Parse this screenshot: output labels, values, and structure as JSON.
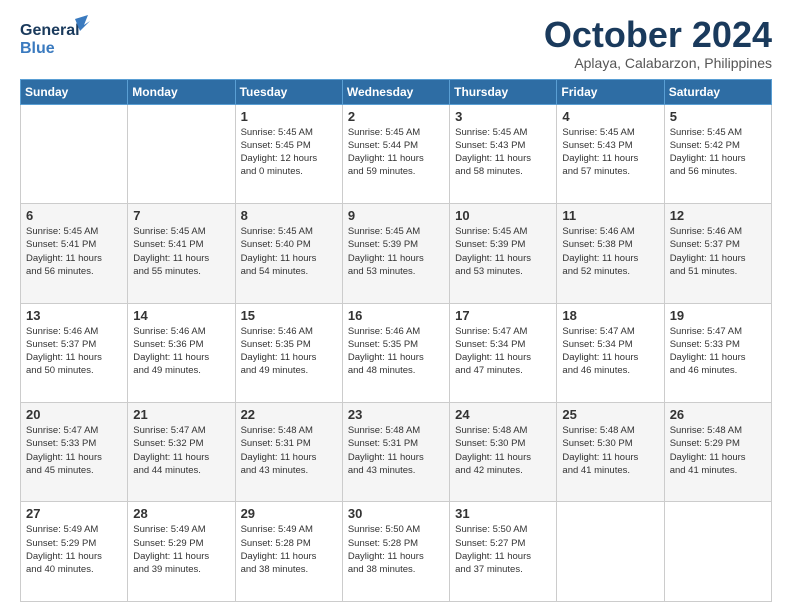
{
  "header": {
    "logo_general": "General",
    "logo_blue": "Blue",
    "month_title": "October 2024",
    "location": "Aplaya, Calabarzon, Philippines"
  },
  "weekdays": [
    "Sunday",
    "Monday",
    "Tuesday",
    "Wednesday",
    "Thursday",
    "Friday",
    "Saturday"
  ],
  "weeks": [
    [
      {
        "day": "",
        "info": ""
      },
      {
        "day": "",
        "info": ""
      },
      {
        "day": "1",
        "info": "Sunrise: 5:45 AM\nSunset: 5:45 PM\nDaylight: 12 hours\nand 0 minutes."
      },
      {
        "day": "2",
        "info": "Sunrise: 5:45 AM\nSunset: 5:44 PM\nDaylight: 11 hours\nand 59 minutes."
      },
      {
        "day": "3",
        "info": "Sunrise: 5:45 AM\nSunset: 5:43 PM\nDaylight: 11 hours\nand 58 minutes."
      },
      {
        "day": "4",
        "info": "Sunrise: 5:45 AM\nSunset: 5:43 PM\nDaylight: 11 hours\nand 57 minutes."
      },
      {
        "day": "5",
        "info": "Sunrise: 5:45 AM\nSunset: 5:42 PM\nDaylight: 11 hours\nand 56 minutes."
      }
    ],
    [
      {
        "day": "6",
        "info": "Sunrise: 5:45 AM\nSunset: 5:41 PM\nDaylight: 11 hours\nand 56 minutes."
      },
      {
        "day": "7",
        "info": "Sunrise: 5:45 AM\nSunset: 5:41 PM\nDaylight: 11 hours\nand 55 minutes."
      },
      {
        "day": "8",
        "info": "Sunrise: 5:45 AM\nSunset: 5:40 PM\nDaylight: 11 hours\nand 54 minutes."
      },
      {
        "day": "9",
        "info": "Sunrise: 5:45 AM\nSunset: 5:39 PM\nDaylight: 11 hours\nand 53 minutes."
      },
      {
        "day": "10",
        "info": "Sunrise: 5:45 AM\nSunset: 5:39 PM\nDaylight: 11 hours\nand 53 minutes."
      },
      {
        "day": "11",
        "info": "Sunrise: 5:46 AM\nSunset: 5:38 PM\nDaylight: 11 hours\nand 52 minutes."
      },
      {
        "day": "12",
        "info": "Sunrise: 5:46 AM\nSunset: 5:37 PM\nDaylight: 11 hours\nand 51 minutes."
      }
    ],
    [
      {
        "day": "13",
        "info": "Sunrise: 5:46 AM\nSunset: 5:37 PM\nDaylight: 11 hours\nand 50 minutes."
      },
      {
        "day": "14",
        "info": "Sunrise: 5:46 AM\nSunset: 5:36 PM\nDaylight: 11 hours\nand 49 minutes."
      },
      {
        "day": "15",
        "info": "Sunrise: 5:46 AM\nSunset: 5:35 PM\nDaylight: 11 hours\nand 49 minutes."
      },
      {
        "day": "16",
        "info": "Sunrise: 5:46 AM\nSunset: 5:35 PM\nDaylight: 11 hours\nand 48 minutes."
      },
      {
        "day": "17",
        "info": "Sunrise: 5:47 AM\nSunset: 5:34 PM\nDaylight: 11 hours\nand 47 minutes."
      },
      {
        "day": "18",
        "info": "Sunrise: 5:47 AM\nSunset: 5:34 PM\nDaylight: 11 hours\nand 46 minutes."
      },
      {
        "day": "19",
        "info": "Sunrise: 5:47 AM\nSunset: 5:33 PM\nDaylight: 11 hours\nand 46 minutes."
      }
    ],
    [
      {
        "day": "20",
        "info": "Sunrise: 5:47 AM\nSunset: 5:33 PM\nDaylight: 11 hours\nand 45 minutes."
      },
      {
        "day": "21",
        "info": "Sunrise: 5:47 AM\nSunset: 5:32 PM\nDaylight: 11 hours\nand 44 minutes."
      },
      {
        "day": "22",
        "info": "Sunrise: 5:48 AM\nSunset: 5:31 PM\nDaylight: 11 hours\nand 43 minutes."
      },
      {
        "day": "23",
        "info": "Sunrise: 5:48 AM\nSunset: 5:31 PM\nDaylight: 11 hours\nand 43 minutes."
      },
      {
        "day": "24",
        "info": "Sunrise: 5:48 AM\nSunset: 5:30 PM\nDaylight: 11 hours\nand 42 minutes."
      },
      {
        "day": "25",
        "info": "Sunrise: 5:48 AM\nSunset: 5:30 PM\nDaylight: 11 hours\nand 41 minutes."
      },
      {
        "day": "26",
        "info": "Sunrise: 5:48 AM\nSunset: 5:29 PM\nDaylight: 11 hours\nand 41 minutes."
      }
    ],
    [
      {
        "day": "27",
        "info": "Sunrise: 5:49 AM\nSunset: 5:29 PM\nDaylight: 11 hours\nand 40 minutes."
      },
      {
        "day": "28",
        "info": "Sunrise: 5:49 AM\nSunset: 5:29 PM\nDaylight: 11 hours\nand 39 minutes."
      },
      {
        "day": "29",
        "info": "Sunrise: 5:49 AM\nSunset: 5:28 PM\nDaylight: 11 hours\nand 38 minutes."
      },
      {
        "day": "30",
        "info": "Sunrise: 5:50 AM\nSunset: 5:28 PM\nDaylight: 11 hours\nand 38 minutes."
      },
      {
        "day": "31",
        "info": "Sunrise: 5:50 AM\nSunset: 5:27 PM\nDaylight: 11 hours\nand 37 minutes."
      },
      {
        "day": "",
        "info": ""
      },
      {
        "day": "",
        "info": ""
      }
    ]
  ]
}
